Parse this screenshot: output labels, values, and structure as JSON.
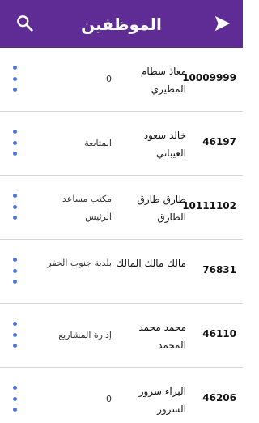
{
  "header": {
    "title": "الموظفين",
    "search_icon": "search-icon",
    "send_icon": "send-icon",
    "color": "#5f2b94"
  },
  "employees": [
    {
      "id": "10009999",
      "name": "معاذ سطام المطيري",
      "dept": "0"
    },
    {
      "id": "46197",
      "name": "خالد سعود العيباني",
      "dept": "المتابعة"
    },
    {
      "id": "10111102",
      "name": "طارق طارق الطارق",
      "dept": "مكتب مساعد الرئيس"
    },
    {
      "id": "76831",
      "name": "مالك مالك المالك",
      "dept": "بلدية جنوب الحفر"
    },
    {
      "id": "46110",
      "name": "محمد محمد المحمد",
      "dept": "إدارة المشاريع"
    },
    {
      "id": "46206",
      "name": "البراء سرور السرور",
      "dept": "0"
    }
  ]
}
